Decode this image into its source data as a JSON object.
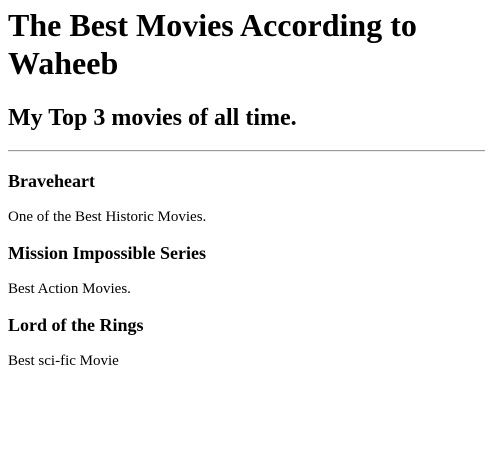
{
  "page": {
    "heading": "The Best Movies According to Waheeb",
    "subheading": "My Top 3 movies of all time."
  },
  "movies": [
    {
      "title": "Braveheart",
      "description": "One of the Best Historic Movies."
    },
    {
      "title": "Mission Impossible Series",
      "description": "Best Action Movies."
    },
    {
      "title": "Lord of the Rings",
      "description": "Best sci-fic Movie"
    }
  ]
}
